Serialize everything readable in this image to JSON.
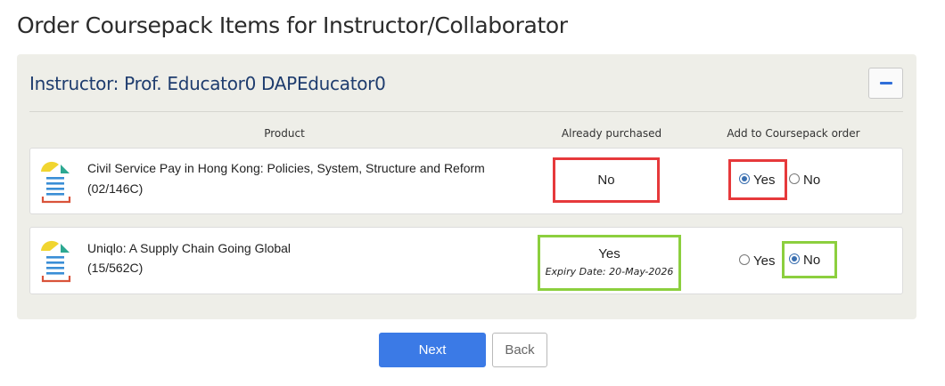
{
  "page": {
    "title": "Order Coursepack Items for Instructor/Collaborator"
  },
  "panel": {
    "title": "Instructor: Prof. Educator0 DAPEducator0",
    "collapse_icon": "minus-icon",
    "columns": {
      "product": "Product",
      "purchased": "Already purchased",
      "add": "Add to Coursepack order"
    }
  },
  "items": [
    {
      "title": "Civil Service Pay in Hong Kong: Policies, System, Structure and Reform",
      "code": "(02/146C)",
      "purchased": "No",
      "expiry": "",
      "options": {
        "yes": "Yes",
        "no": "No"
      },
      "selected": "Yes"
    },
    {
      "title": "Uniqlo: A Supply Chain Going Global",
      "code": "(15/562C)",
      "purchased": "Yes",
      "expiry": "Expiry Date: 20-May-2026",
      "options": {
        "yes": "Yes",
        "no": "No"
      },
      "selected": "No"
    }
  ],
  "actions": {
    "next": "Next",
    "back": "Back"
  },
  "colors": {
    "primary": "#3b7ae6",
    "highlight_red": "#e6393b",
    "highlight_green": "#8ccf3e",
    "heading": "#1e3c6e"
  }
}
